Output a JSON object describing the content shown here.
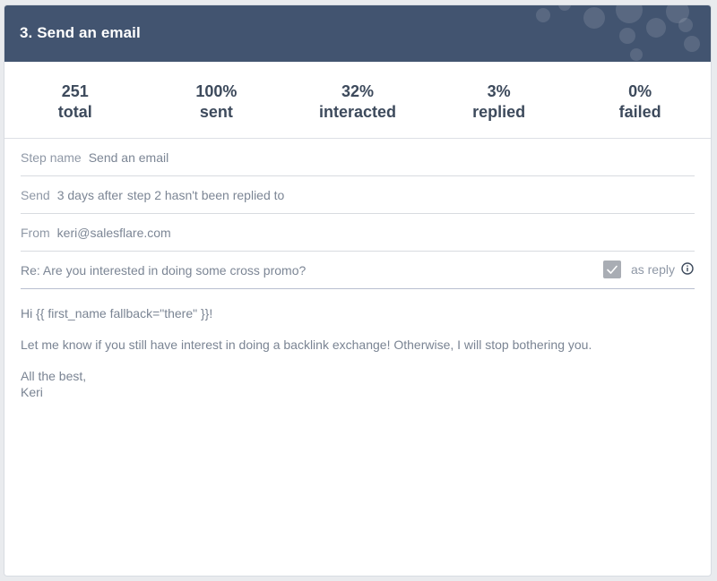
{
  "header": {
    "title": "3. Send an email"
  },
  "stats": [
    {
      "value": "251",
      "label": "total"
    },
    {
      "value": "100%",
      "label": "sent"
    },
    {
      "value": "32%",
      "label": "interacted"
    },
    {
      "value": "3%",
      "label": "replied"
    },
    {
      "value": "0%",
      "label": "failed"
    }
  ],
  "step_name": {
    "label": "Step name",
    "value": "Send an email"
  },
  "send": {
    "label": "Send",
    "delay": "3 days after",
    "condition": "step 2 hasn't been replied to"
  },
  "from": {
    "label": "From",
    "value": "keri@salesflare.com"
  },
  "subject": {
    "value": "Re: Are you interested in doing some cross promo?"
  },
  "as_reply": {
    "label": "as reply",
    "checked": true
  },
  "email_body": {
    "greeting": "Hi {{ first_name fallback=\"there\" }}!",
    "paragraph": "Let me know if you still have interest in doing a backlink exchange! Otherwise, I will stop bothering you.",
    "signoff": "All the best,",
    "signature": "Keri"
  },
  "colors": {
    "header_bg": "#425470",
    "text_dark": "#3d4a5c",
    "text_muted": "#8f98a6",
    "checkbox": "#a9adb4"
  },
  "icons": {
    "checkbox": "check-icon",
    "info": "info-icon"
  }
}
